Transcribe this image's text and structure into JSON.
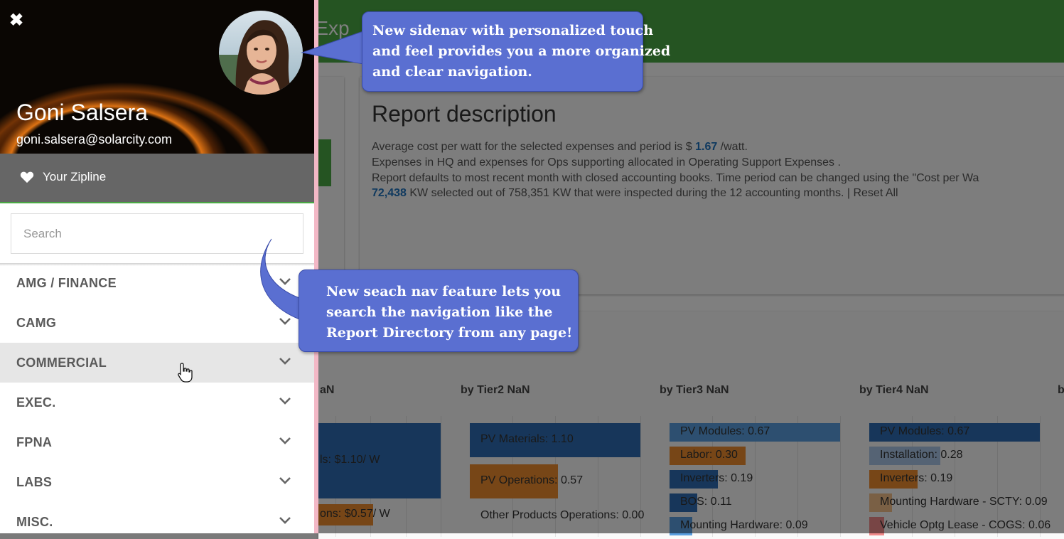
{
  "background": {
    "topbar_title": "g Exp",
    "report": {
      "title": "Report description",
      "line1_prefix": "Average cost per watt for the selected expenses and period is $ ",
      "line1_value": "1.67",
      "line1_suffix": " /watt.",
      "line2": "Expenses in HQ and expenses for Ops supporting allocated in Operating Support Expenses      .",
      "line3": "Report defaults to most recent month with closed accounting books. Time period can be changed using the \"Cost per Wa",
      "line4_value": "72,438",
      "line4_suffix": " KW selected out of 758,351 KW that were inspected during the 12 accounting months. | Reset All"
    },
    "tiers": [
      {
        "title": "aN"
      },
      {
        "title": "by Tier2 NaN"
      },
      {
        "title": "by Tier3 NaN"
      },
      {
        "title": "by Tier4 NaN"
      },
      {
        "title": "b"
      }
    ],
    "chart_data": [
      {
        "type": "bar",
        "title": "aN",
        "bars": [
          {
            "label": "ls: $1.10/ W",
            "value": 1.1,
            "color": "#2f6db5"
          },
          {
            "label": "ons: $0.57/ W",
            "value": 0.57,
            "color": "#ef8d2e"
          }
        ]
      },
      {
        "type": "bar",
        "title": "by Tier2 NaN",
        "bars": [
          {
            "label": "PV Materials: 1.10",
            "value": 1.1,
            "color": "#2f6db5"
          },
          {
            "label": "PV Operations: 0.57",
            "value": 0.57,
            "color": "#ef8d2e"
          },
          {
            "label": "Other Products Operations: 0.00",
            "value": 0.0,
            "color": "#aac7e8"
          }
        ]
      },
      {
        "type": "bar",
        "title": "by Tier3 NaN",
        "bars": [
          {
            "label": "PV Modules: 0.67",
            "value": 0.67,
            "color": "#5a9fe0"
          },
          {
            "label": "Labor: 0.30",
            "value": 0.3,
            "color": "#ef8d2e"
          },
          {
            "label": "Inverters: 0.19",
            "value": 0.19,
            "color": "#2f6db5"
          },
          {
            "label": "BOS: 0.11",
            "value": 0.11,
            "color": "#2f6db5"
          },
          {
            "label": "Mounting Hardware: 0.09",
            "value": 0.09,
            "color": "#5a9fe0"
          }
        ]
      },
      {
        "type": "bar",
        "title": "by Tier4 NaN",
        "bars": [
          {
            "label": "PV Modules: 0.67",
            "value": 0.67,
            "color": "#2f6db5"
          },
          {
            "label": "Installation: 0.28",
            "value": 0.28,
            "color": "#aac7e8"
          },
          {
            "label": "Inverters: 0.19",
            "value": 0.19,
            "color": "#ef8d2e"
          },
          {
            "label": "Mounting Hardware - SCTY: 0.09",
            "value": 0.09,
            "color": "#f5c08a"
          },
          {
            "label": "Vehicle Optg Lease - COGS: 0.06",
            "value": 0.06,
            "color": "#f08a8a"
          }
        ]
      }
    ]
  },
  "sidenav": {
    "user": {
      "name": "Goni Salsera",
      "email": "goni.salsera@solarcity.com"
    },
    "zipline_label": "Your Zipline",
    "search": {
      "placeholder": "Search",
      "value": ""
    },
    "items": [
      {
        "label": "AMG / FINANCE"
      },
      {
        "label": "CAMG"
      },
      {
        "label": "COMMERCIAL"
      },
      {
        "label": "EXEC."
      },
      {
        "label": "FPNA"
      },
      {
        "label": "LABS"
      },
      {
        "label": "MISC."
      }
    ],
    "hovered_index": 2
  },
  "callouts": {
    "c1": [
      "New sidenav with personalized touch",
      "and feel provides you a more organized",
      "and clear navigation."
    ],
    "c2": [
      "New seach nav feature lets you",
      "search the navigation like the",
      "Report Directory from any page!"
    ]
  },
  "colors": {
    "topbar_green": "#4aa844",
    "callout_blue": "#5a6fd1",
    "zipline_gray": "#666666",
    "link_blue": "#1e73be"
  }
}
